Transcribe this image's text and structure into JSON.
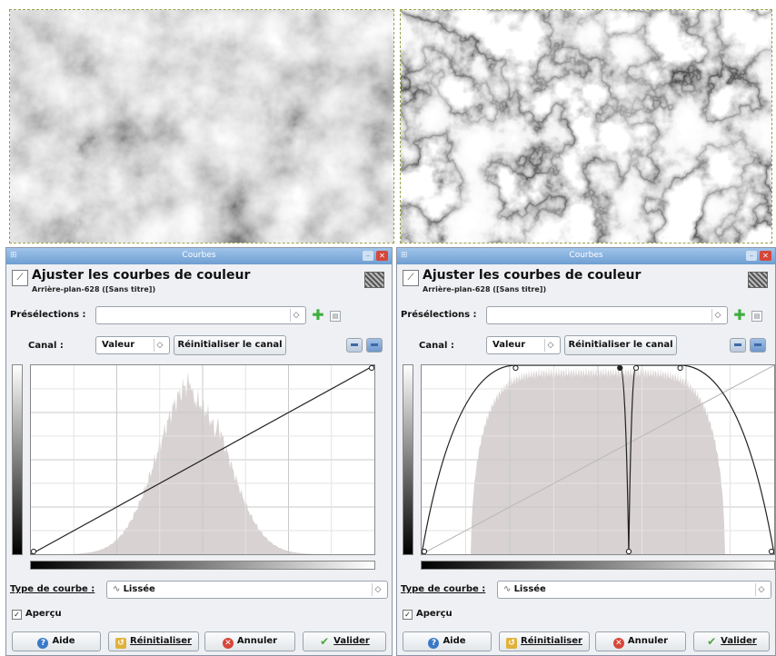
{
  "dialogs": [
    {
      "window_title": "Courbes",
      "header_title": "Ajuster les courbes de couleur",
      "header_subtitle": "Arrière-plan-628 ([Sans titre])",
      "presets_label": "Présélections :",
      "presets_value": "",
      "channel_label": "Canal :",
      "channel_value": "Valeur",
      "reset_channel_label": "Réinitialiser le canal",
      "curve_type_label": "Type de courbe :",
      "curve_type_value": "Lissée",
      "preview_label": "Aperçu",
      "preview_checked": true,
      "buttons": {
        "help": "Aide",
        "reset": "Réinitialiser",
        "cancel": "Annuler",
        "ok": "Valider"
      },
      "curve_points": [
        [
          0,
          0
        ],
        [
          255,
          255
        ]
      ]
    },
    {
      "window_title": "Courbes",
      "header_title": "Ajuster les courbes de couleur",
      "header_subtitle": "Arrière-plan-628 ([Sans titre])",
      "presets_label": "Présélections :",
      "presets_value": "",
      "channel_label": "Canal :",
      "channel_value": "Valeur",
      "reset_channel_label": "Réinitialiser le canal",
      "curve_type_label": "Type de courbe :",
      "curve_type_value": "Lissée",
      "preview_label": "Aperçu",
      "preview_checked": true,
      "buttons": {
        "help": "Aide",
        "reset": "Réinitialiser",
        "cancel": "Annuler",
        "ok": "Valider"
      },
      "curve_points": [
        [
          0,
          0
        ],
        [
          128,
          255
        ],
        [
          270,
          255
        ],
        [
          282,
          0
        ],
        [
          292,
          255
        ],
        [
          352,
          255
        ],
        [
          480,
          0
        ]
      ]
    }
  ],
  "colors": {
    "title_bar": "#6e9ed2",
    "histogram": "#d8d2d2",
    "dialog_bg": "#eef0f3",
    "close_button": "#d6463a"
  },
  "icons": {
    "window": "curves-icon",
    "help": "help-icon",
    "reset": "reset-icon",
    "cancel": "cancel-icon",
    "ok": "checkmark-icon",
    "add": "plus-icon",
    "menu": "menu-icon"
  }
}
